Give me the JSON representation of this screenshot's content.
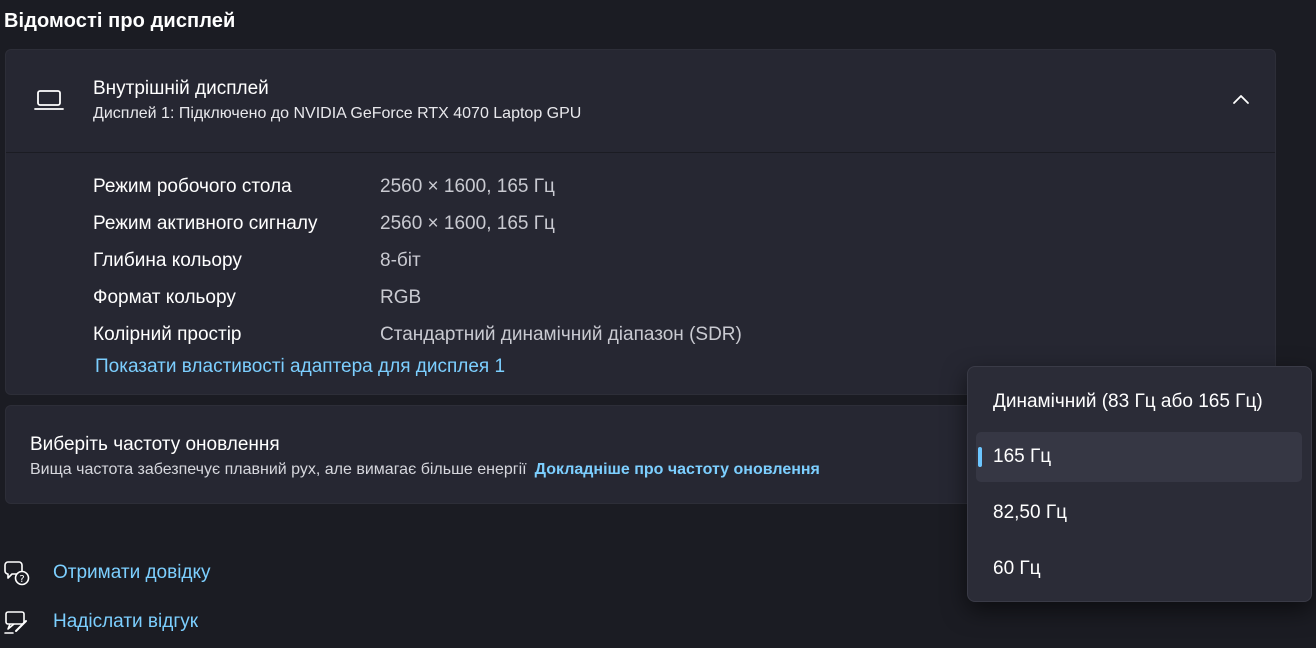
{
  "section_title": "Відомості про дисплей",
  "display_card": {
    "icon": "laptop-icon",
    "title": "Внутрішній дисплей",
    "subtitle": "Дисплей 1: Підключено до NVIDIA GeForce RTX 4070 Laptop GPU",
    "expanded": true,
    "rows": [
      {
        "label": "Режим робочого стола",
        "value": "2560 × 1600, 165 Гц"
      },
      {
        "label": "Режим активного сигналу",
        "value": "2560 × 1600, 165 Гц"
      },
      {
        "label": "Глибина кольору",
        "value": "8-біт"
      },
      {
        "label": "Формат кольору",
        "value": "RGB"
      },
      {
        "label": "Колірний простір",
        "value": "Стандартний динамічний діапазон (SDR)"
      }
    ],
    "adapter_link": "Показати властивості адаптера для дисплея 1"
  },
  "refresh_card": {
    "title": "Виберіть частоту оновлення",
    "description": "Вища частота забезпечує плавний рух, але вимагає більше енергії",
    "link": "Докладніше про частоту оновлення"
  },
  "bottom_links": {
    "help": {
      "label": "Отримати довідку",
      "icon": "help-chat-icon"
    },
    "feedback": {
      "label": "Надіслати відгук",
      "icon": "feedback-icon"
    }
  },
  "refresh_dropdown": {
    "options": [
      {
        "label": "Динамічний (83 Гц або 165 Гц)",
        "selected": false
      },
      {
        "label": "165 Гц",
        "selected": true
      },
      {
        "label": "82,50 Гц",
        "selected": false
      },
      {
        "label": "60 Гц",
        "selected": false
      }
    ]
  },
  "colors": {
    "background": "#1b1c23",
    "card": "#262732",
    "accent_link": "#7ccfff",
    "selection_indicator": "#6cc6ff"
  }
}
